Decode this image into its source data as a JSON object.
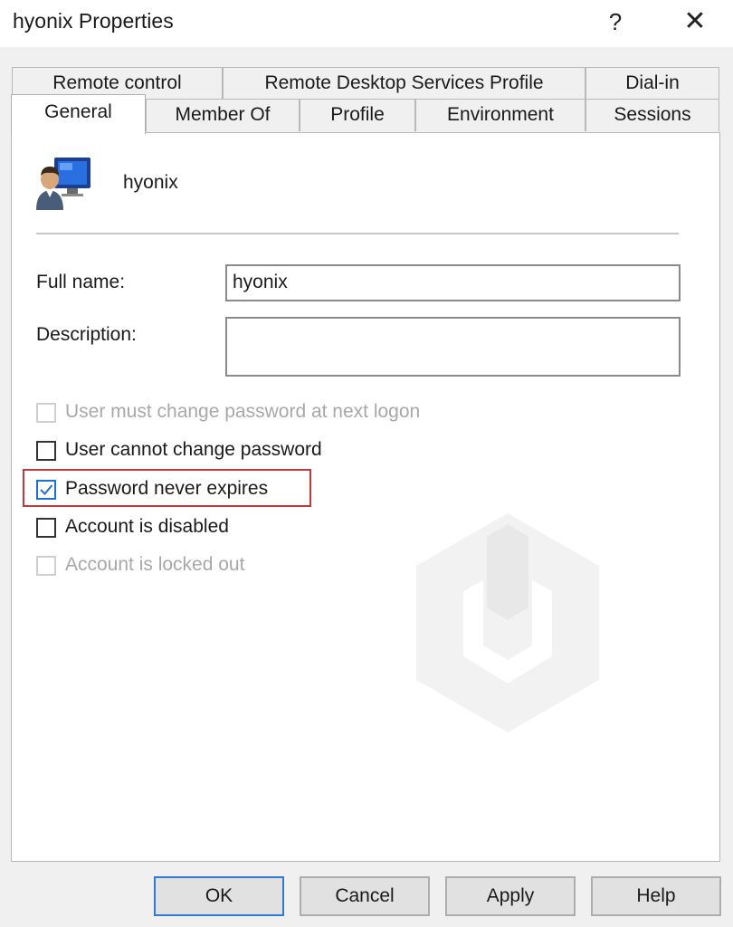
{
  "window": {
    "title": "hyonix Properties",
    "help_label": "?",
    "close_label": "✕"
  },
  "tabs": {
    "back_row": [
      "Remote control",
      "Remote Desktop Services Profile",
      "Dial-in"
    ],
    "front_row": [
      "General",
      "Member Of",
      "Profile",
      "Environment",
      "Sessions"
    ],
    "active": "General"
  },
  "general": {
    "user_icon": "user-computer-icon",
    "user_name": "hyonix",
    "full_name_label": "Full name:",
    "full_name_value": "hyonix",
    "description_label": "Description:",
    "description_value": ""
  },
  "checkboxes": [
    {
      "label": "User must change password at next logon",
      "checked": false,
      "enabled": false
    },
    {
      "label": "User cannot change password",
      "checked": false,
      "enabled": true
    },
    {
      "label": "Password never expires",
      "checked": true,
      "enabled": true
    },
    {
      "label": "Account is disabled",
      "checked": false,
      "enabled": true
    },
    {
      "label": "Account is locked out",
      "checked": false,
      "enabled": false
    }
  ],
  "buttons": {
    "ok": "OK",
    "cancel": "Cancel",
    "apply": "Apply",
    "help": "Help"
  },
  "colors": {
    "highlight": "#c0393b",
    "check": "#1f6fd1",
    "default_button_border": "#2f7ad6"
  }
}
